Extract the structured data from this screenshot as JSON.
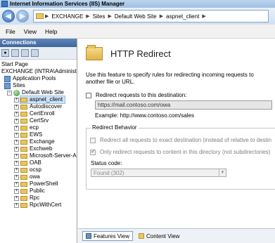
{
  "window": {
    "title": "Internet Information Services (IIS) Manager"
  },
  "address": {
    "back_icon": "back-arrow-icon",
    "forward_icon": "forward-arrow-icon",
    "crumbs": [
      "EXCHANGE",
      "Sites",
      "Default Web Site",
      "aspnet_client"
    ],
    "separator": "▶"
  },
  "menu": {
    "file": "File",
    "view": "View",
    "help": "Help"
  },
  "connections": {
    "header": "Connections",
    "tree": {
      "start_page": "Start Page",
      "server": "EXCHANGE (INTRA\\Administrat",
      "app_pools": "Application Pools",
      "sites": "Sites",
      "default_site": "Default Web Site",
      "children": [
        "aspnet_client",
        "Autodiscover",
        "CertEnroll",
        "CertSrv",
        "ecp",
        "EWS",
        "Exchange",
        "Exchweb",
        "Microsoft-Server-Ac",
        "OAB",
        "ocsp",
        "owa",
        "PowerShell",
        "Public",
        "Rpc",
        "RpcWithCert"
      ],
      "expander": "+"
    }
  },
  "content": {
    "title": "HTTP Redirect",
    "description": "Use this feature to specify rules for redirecting incoming requests to another file or URL.",
    "redirect_label": "Redirect requests to this destination:",
    "redirect_url": "https://mail.contoso.com/owa",
    "example": "Example: http://www.contoso.com/sales",
    "behavior": {
      "title": "Redirect Behavior",
      "exact_label": "Redirect all requests to exact destination (instead of relative to destin",
      "only_dir_label": "Only redirect requests to content in this directory (not subdirectories)",
      "status_label": "Status code:",
      "status_value": "Found (302)"
    }
  },
  "bottom": {
    "features_view": "Features View",
    "content_view": "Content View"
  }
}
